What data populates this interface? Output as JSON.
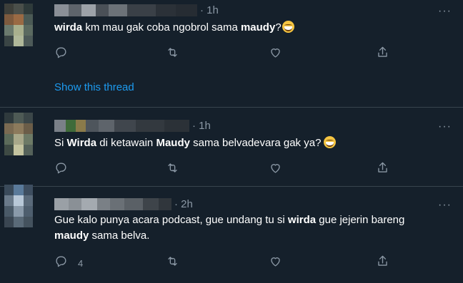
{
  "colors": {
    "background": "#15202b",
    "divider": "#38444d",
    "muted": "#8b98a5",
    "link": "#1d9bf0",
    "text": "#ffffff"
  },
  "tweets": [
    {
      "time": "· 1h",
      "text": [
        {
          "t": "wirda",
          "b": true
        },
        {
          "t": " km mau gak coba ngobrol sama ",
          "b": false
        },
        {
          "t": "maudy",
          "b": true
        },
        {
          "t": "?",
          "b": false
        }
      ],
      "emoji": "grinning-face",
      "reply_count": "",
      "show_thread": "Show this thread",
      "avatar_colors": [
        "#3d3f3a",
        "#4a4f4a",
        "#2e3a3a",
        "#7d5a3e",
        "#9a6a44",
        "#4b5a55",
        "#6b7a6e",
        "#a9b08e",
        "#5b6a60",
        "#3a4545",
        "#b0b89a",
        "#4d5a58"
      ],
      "name_colors": [
        "#8a8f97",
        "#5e646b",
        "#9da2a8",
        "#4a5057",
        "#6c7278",
        "#3a4047",
        "#2b3138",
        "#262c33"
      ]
    },
    {
      "time": "· 1h",
      "text": [
        {
          "t": "Si ",
          "b": false
        },
        {
          "t": "Wirda",
          "b": true
        },
        {
          "t": " di ketawain ",
          "b": false
        },
        {
          "t": "Maudy",
          "b": true
        },
        {
          "t": " sama belvadevara gak ya?",
          "b": false
        }
      ],
      "emoji": "grinning-face",
      "reply_count": "",
      "show_thread": "",
      "avatar_colors": [
        "#2f3a3d",
        "#4e5a55",
        "#3b4648",
        "#7a6a52",
        "#8c7a5c",
        "#6b5d48",
        "#5c6b5a",
        "#a8a88a",
        "#6d7a66",
        "#3e4a44",
        "#c4c4a0",
        "#55625a"
      ],
      "name_colors": [
        "#7a8088",
        "#3f6b3a",
        "#8a7a4a",
        "#4e555c",
        "#5e646b",
        "#40464d",
        "#33393f",
        "#2b3137"
      ]
    },
    {
      "time": "· 2h",
      "text": [
        {
          "t": "Gue kalo punya acara podcast, gue undang tu si ",
          "b": false
        },
        {
          "t": "wirda",
          "b": true
        },
        {
          "t": " gue jejerin bareng ",
          "b": false
        },
        {
          "t": "maudy",
          "b": true
        },
        {
          "t": " sama belva.",
          "b": false
        }
      ],
      "emoji": "",
      "reply_count": "4",
      "show_thread": "",
      "avatar_colors": [
        "#3a4a5a",
        "#5a7a9a",
        "#3e4e60",
        "#6a7a8a",
        "#b8c8d8",
        "#5a6a7a",
        "#4a5a68",
        "#8a9aaa",
        "#4e5e6e",
        "#3a4652",
        "#5a6a78",
        "#44525e"
      ],
      "name_colors": [
        "#9aa0a6",
        "#8a9096",
        "#a4aab0",
        "#7a8086",
        "#6a7076",
        "#5a6066",
        "#3e444a",
        "#30363c"
      ]
    }
  ]
}
